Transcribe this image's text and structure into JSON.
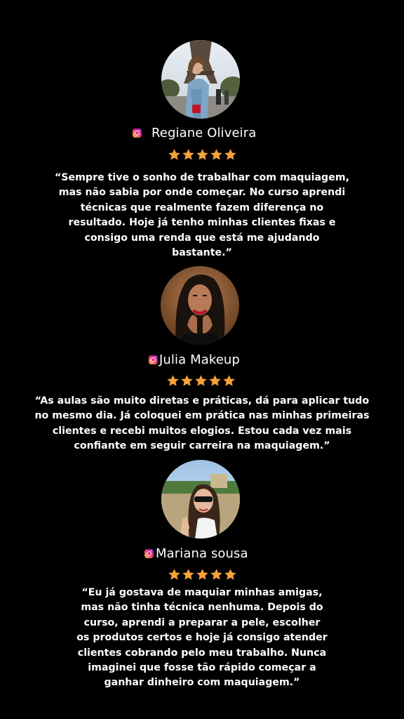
{
  "colors": {
    "background": "#000000",
    "text": "#ffffff",
    "star": "#f4a23a",
    "instagram_gradient": [
      "#f9ce34",
      "#ee2a7b",
      "#6228d7"
    ]
  },
  "testimonials": [
    {
      "name": "Regiane Oliveira",
      "icon": "instagram-icon",
      "rating": 5,
      "quote_lines": [
        "“Sempre tive o sonho de trabalhar com maquiagem,",
        "mas não sabia por onde começar. No curso aprendi",
        "técnicas que realmente fazem diferença no",
        "resultado. Hoje já tenho minhas clientes fixas e",
        "consigo uma renda que está me ajudando",
        "bastante.”"
      ]
    },
    {
      "name": "Julia Makeup",
      "icon": "instagram-icon",
      "rating": 5,
      "quote_lines": [
        "“As aulas são muito diretas e práticas, dá para aplicar tudo",
        "no mesmo dia. Já coloquei em prática nas minhas primeiras",
        "clientes e recebi muitos elogios. Estou cada vez mais",
        "confiante em seguir carreira na maquiagem.”"
      ]
    },
    {
      "name": "Mariana sousa",
      "icon": "instagram-icon",
      "rating": 5,
      "quote_lines": [
        "“Eu já gostava de maquiar minhas amigas,",
        "mas não tinha técnica nenhuma. Depois do",
        "curso, aprendi a preparar a pele, escolher",
        "os produtos certos e hoje já consigo atender",
        "clientes cobrando pelo meu trabalho. Nunca",
        "imaginei que fosse tão rápido começar a",
        "ganhar dinheiro com maquiagem.”"
      ]
    }
  ]
}
